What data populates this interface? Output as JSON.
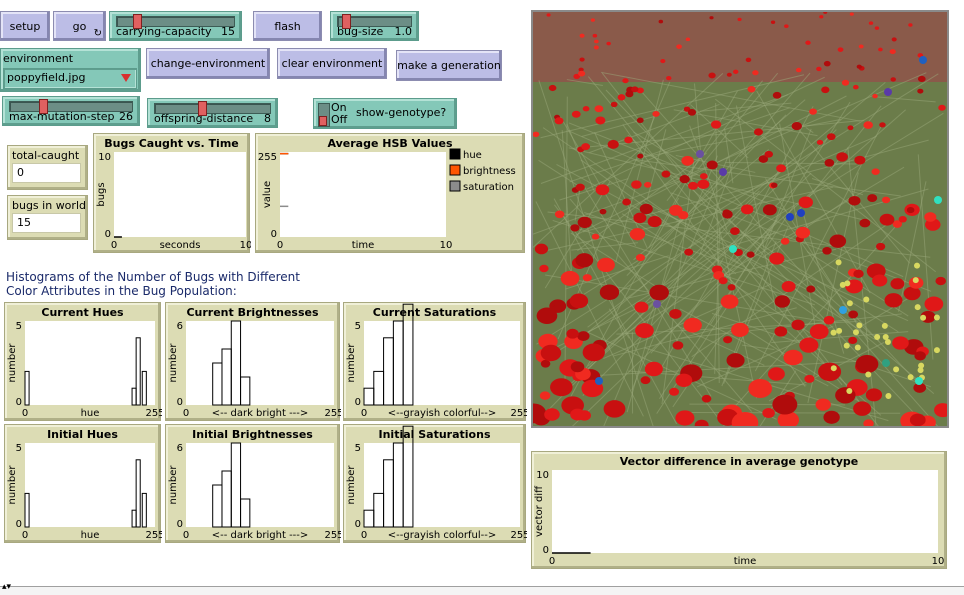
{
  "buttons": {
    "setup": "setup",
    "go": "go",
    "flash": "flash",
    "change_environment": "change-environment",
    "clear_environment": "clear environment",
    "make_generation": "make a generation"
  },
  "sliders": {
    "carrying_capacity": {
      "label": "carrying-capacity",
      "value": "15",
      "fraction": 0.15
    },
    "bug_size": {
      "label": "bug-size",
      "value": "1.0",
      "fraction": 0.08
    },
    "max_mutation_step": {
      "label": "max-mutation-step",
      "value": "26",
      "fraction": 0.26
    },
    "offspring_distance": {
      "label": "offspring-distance",
      "value": "8",
      "fraction": 0.4
    }
  },
  "chooser": {
    "label": "environment",
    "value": "poppyfield.jpg"
  },
  "switch": {
    "on_label": "On",
    "off_label": "Off",
    "label": "show-genotype?",
    "state": "off"
  },
  "monitors": {
    "total_caught": {
      "label": "total-caught",
      "value": "0"
    },
    "bugs_in_world": {
      "label": "bugs in world",
      "value": "15"
    }
  },
  "note": {
    "line1": "Histograms of the Number of Bugs with Different",
    "line2": "Color Attributes in the Bug Population:"
  },
  "colors": {
    "button": "#bcbde6",
    "slider": "#84c8b8",
    "monitor": "#dcdcb4",
    "knob": "#e06060",
    "hue": "#000000",
    "brightness": "#ff5500",
    "saturation": "#8c8c8c"
  },
  "chart_data": [
    {
      "type": "line",
      "title": "Bugs Caught vs. Time",
      "xlabel": "seconds",
      "ylabel": "bugs",
      "xlim": [
        0,
        10
      ],
      "ylim": [
        0,
        10
      ],
      "x_ticks": [
        "0",
        "10"
      ],
      "y_ticks": [
        "0",
        "10"
      ],
      "series": [
        {
          "values": [
            [
              0,
              0
            ],
            [
              0.3,
              0
            ],
            [
              0.6,
              0
            ]
          ]
        }
      ]
    },
    {
      "type": "line",
      "title": "Average HSB Values",
      "xlabel": "time",
      "ylabel": "value",
      "xlim": [
        0,
        10
      ],
      "ylim": [
        0,
        255
      ],
      "x_ticks": [
        "0",
        "10"
      ],
      "y_ticks": [
        "0",
        "255"
      ],
      "legend": [
        "hue",
        "brightness",
        "saturation"
      ],
      "series": [
        {
          "name": "hue",
          "values": [
            [
              0,
              250
            ],
            [
              0.5,
              250
            ]
          ]
        },
        {
          "name": "brightness",
          "values": [
            [
              0,
              250
            ],
            [
              0.5,
              250
            ]
          ]
        },
        {
          "name": "saturation",
          "values": [
            [
              0,
              92
            ],
            [
              0.5,
              92
            ]
          ]
        }
      ]
    },
    {
      "type": "bar",
      "title": "Current Hues",
      "xlabel": "hue",
      "ylabel": "number",
      "xlim": [
        0,
        255
      ],
      "ylim": [
        0,
        5
      ],
      "x_ticks": [
        "0",
        "255"
      ],
      "y_ticks": [
        "0",
        "5"
      ],
      "bins": [
        [
          0,
          2
        ],
        [
          210,
          1
        ],
        [
          218,
          4
        ],
        [
          230,
          2
        ]
      ],
      "bin_width": 8
    },
    {
      "type": "bar",
      "title": "Current Brightnesses",
      "xlabel": "<-- dark  bright --->",
      "ylabel": "number",
      "xlim": [
        0,
        255
      ],
      "ylim": [
        0,
        6
      ],
      "x_ticks": [
        "0",
        "255"
      ],
      "y_ticks": [
        "0",
        "6"
      ],
      "bins": [
        [
          46,
          3
        ],
        [
          62,
          4
        ],
        [
          78,
          6
        ],
        [
          94,
          2
        ]
      ],
      "bin_width": 16
    },
    {
      "type": "bar",
      "title": "Current Saturations",
      "xlabel": "<--grayish   colorful-->",
      "ylabel": "number",
      "xlim": [
        0,
        255
      ],
      "ylim": [
        0,
        5
      ],
      "x_ticks": [
        "0",
        "255"
      ],
      "y_ticks": [
        "0",
        "5"
      ],
      "bins": [
        [
          0,
          1
        ],
        [
          16,
          2
        ],
        [
          32,
          4
        ],
        [
          48,
          5
        ],
        [
          64,
          6
        ]
      ],
      "bin_width": 16
    },
    {
      "type": "bar",
      "title": "Initial Hues",
      "xlabel": "hue",
      "ylabel": "number",
      "xlim": [
        0,
        255
      ],
      "ylim": [
        0,
        5
      ],
      "x_ticks": [
        "0",
        "255"
      ],
      "y_ticks": [
        "0",
        "5"
      ],
      "bins": [
        [
          0,
          2
        ],
        [
          210,
          1
        ],
        [
          218,
          4
        ],
        [
          230,
          2
        ]
      ],
      "bin_width": 8
    },
    {
      "type": "bar",
      "title": "Initial Brightnesses",
      "xlabel": "<-- dark  bright --->",
      "ylabel": "number",
      "xlim": [
        0,
        255
      ],
      "ylim": [
        0,
        6
      ],
      "x_ticks": [
        "0",
        "255"
      ],
      "y_ticks": [
        "0",
        "6"
      ],
      "bins": [
        [
          46,
          3
        ],
        [
          62,
          4
        ],
        [
          78,
          6
        ],
        [
          94,
          2
        ]
      ],
      "bin_width": 16
    },
    {
      "type": "bar",
      "title": "Initial Saturations",
      "xlabel": "<--grayish   colorful-->",
      "ylabel": "number",
      "xlim": [
        0,
        255
      ],
      "ylim": [
        0,
        5
      ],
      "x_ticks": [
        "0",
        "255"
      ],
      "y_ticks": [
        "0",
        "5"
      ],
      "bins": [
        [
          0,
          1
        ],
        [
          16,
          2
        ],
        [
          32,
          4
        ],
        [
          48,
          5
        ],
        [
          64,
          6
        ]
      ],
      "bin_width": 16
    },
    {
      "type": "line",
      "title": "Vector difference in average genotype",
      "xlabel": "time",
      "ylabel": "vector diff",
      "xlim": [
        0,
        10
      ],
      "ylim": [
        0,
        10
      ],
      "x_ticks": [
        "0",
        "10"
      ],
      "y_ticks": [
        "0",
        "10"
      ],
      "series": [
        {
          "values": [
            [
              0,
              0
            ],
            [
              1,
              0
            ]
          ]
        }
      ]
    }
  ]
}
